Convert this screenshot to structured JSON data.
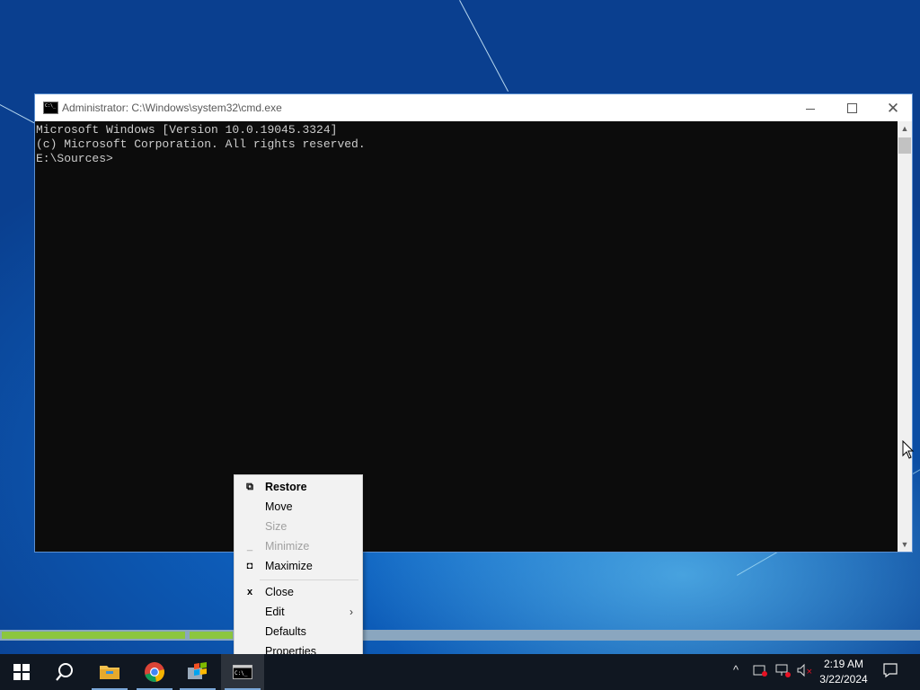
{
  "window": {
    "title": "Administrator: C:\\Windows\\system32\\cmd.exe",
    "console_lines": [
      "Microsoft Windows [Version 10.0.19045.3324]",
      "(c) Microsoft Corporation. All rights reserved.",
      "",
      "E:\\Sources>"
    ]
  },
  "system_menu": {
    "items": [
      {
        "label": "Restore",
        "enabled": true,
        "default": true,
        "icon": "restore-icon"
      },
      {
        "label": "Move",
        "enabled": true
      },
      {
        "label": "Size",
        "enabled": false
      },
      {
        "label": "Minimize",
        "enabled": false,
        "icon": "minimize-icon"
      },
      {
        "label": "Maximize",
        "enabled": true,
        "icon": "maximize-icon"
      },
      {
        "label": "Close",
        "enabled": true,
        "icon": "close-icon"
      },
      {
        "label": "Edit",
        "enabled": true,
        "submenu": true
      },
      {
        "label": "Defaults",
        "enabled": true
      },
      {
        "label": "Properties",
        "enabled": true
      }
    ]
  },
  "taskbar": {
    "apps": [
      "start-icon",
      "search-icon",
      "file-explorer-icon",
      "chrome-icon",
      "windows-setup-icon",
      "cmd-icon"
    ],
    "clock": {
      "time": "2:19 AM",
      "date": "3/22/2024"
    }
  },
  "colors": {
    "console_bg": "#0c0c0c",
    "console_fg": "#cccccc",
    "taskbar_bg": "#101721",
    "progress_fill": "#8cc63f"
  }
}
